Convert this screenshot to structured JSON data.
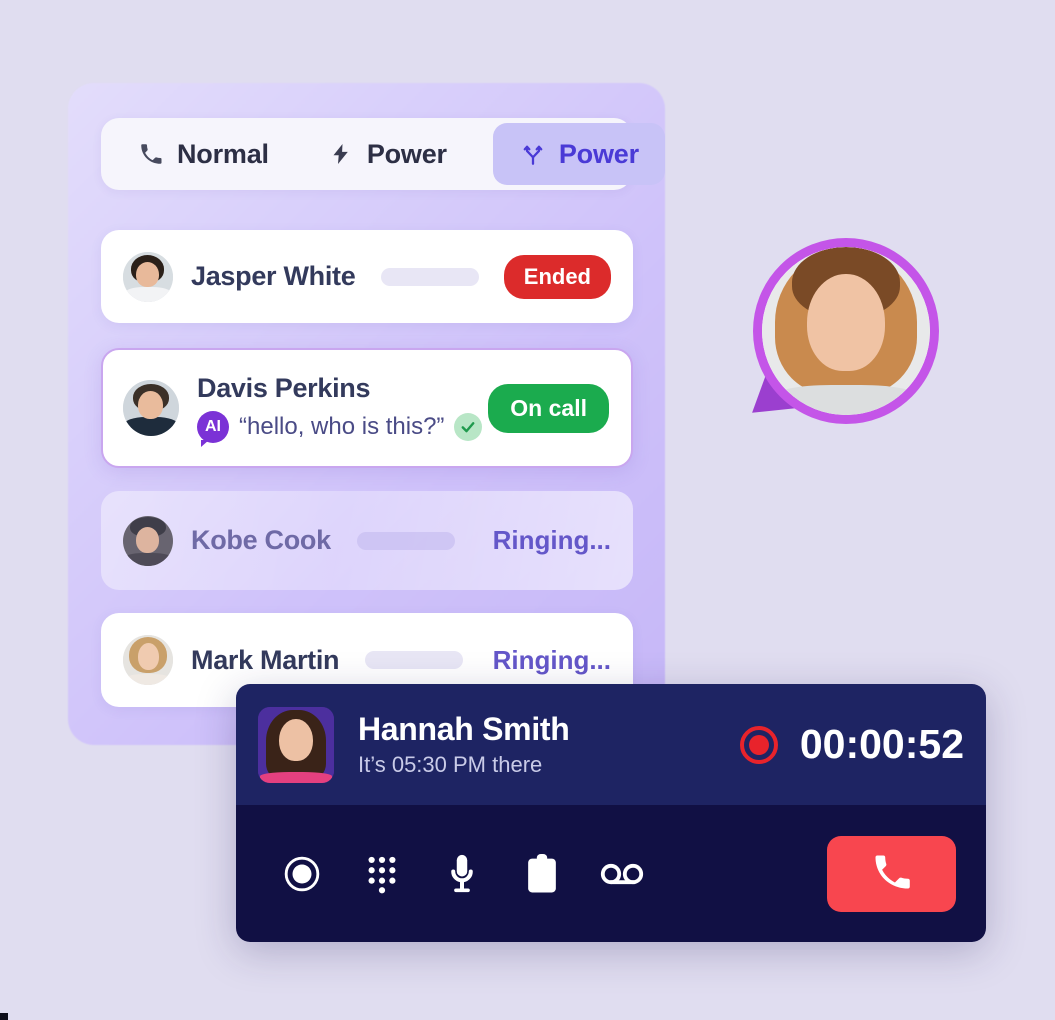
{
  "theme": {
    "bg": "#e0ddf0",
    "panel_gradient_from": "#e3ddfb",
    "panel_gradient_to": "#c6b7f8",
    "accent_purple": "#4a3ad6",
    "tab_active_bg": "#c8c3f7",
    "ended_red": "#dc2b2b",
    "oncall_green": "#1bab4e",
    "ringing_purple": "#6457c9",
    "ring_magenta": "#c455e8",
    "call_panel_top": "#1e2463",
    "call_panel_bottom": "#111044",
    "hangup_red": "#f8464f",
    "record_red": "#e8232b"
  },
  "tabs": [
    {
      "id": "normal",
      "label": "Normal",
      "icon": "phone-icon",
      "active": false
    },
    {
      "id": "power",
      "label": "Power",
      "icon": "bolt-icon",
      "active": false
    },
    {
      "id": "power-branch",
      "label": "Power",
      "icon": "branch-icon",
      "active": true
    }
  ],
  "calls": [
    {
      "id": "jasper",
      "name": "Jasper White",
      "avatar": "avatar-jasper-white",
      "status_label": "Ended",
      "status_type": "ended",
      "has_skeleton": true,
      "selected": false,
      "faded": false
    },
    {
      "id": "davis",
      "name": "Davis Perkins",
      "avatar": "avatar-davis-perkins",
      "status_label": "On call",
      "status_type": "oncall",
      "has_skeleton": false,
      "selected": true,
      "faded": false,
      "ai_badge": "AI",
      "transcript": "“hello, who is this?”",
      "verified": true
    },
    {
      "id": "kobe",
      "name": "Kobe Cook",
      "avatar": "avatar-kobe-cook",
      "status_label": "Ringing...",
      "status_type": "ringing",
      "has_skeleton": true,
      "selected": false,
      "faded": true
    },
    {
      "id": "mark",
      "name": "Mark Martin",
      "avatar": "avatar-mark-martin",
      "status_label": "Ringing...",
      "status_type": "ringing",
      "has_skeleton": true,
      "selected": false,
      "faded": false
    }
  ],
  "highlight_avatar": {
    "name": "avatar-highlighted-agent",
    "ring_color": "#c455e8",
    "pointer": "triangle-pointer"
  },
  "call_panel": {
    "contact_name": "Hannah Smith",
    "local_time": "It’s 05:30 PM there",
    "avatar": "avatar-hannah-smith",
    "recording_indicator": "record-icon",
    "timer": "00:00:52",
    "controls": [
      {
        "id": "record",
        "icon": "record-circle-icon",
        "label": "Record"
      },
      {
        "id": "keypad",
        "icon": "dialpad-icon",
        "label": "Keypad"
      },
      {
        "id": "mute",
        "icon": "microphone-icon",
        "label": "Mute"
      },
      {
        "id": "notes",
        "icon": "clipboard-icon",
        "label": "Notes"
      },
      {
        "id": "voicemail",
        "icon": "voicemail-icon",
        "label": "Voicemail"
      }
    ],
    "hangup": {
      "id": "hangup",
      "icon": "phone-icon",
      "label": "End call"
    }
  }
}
